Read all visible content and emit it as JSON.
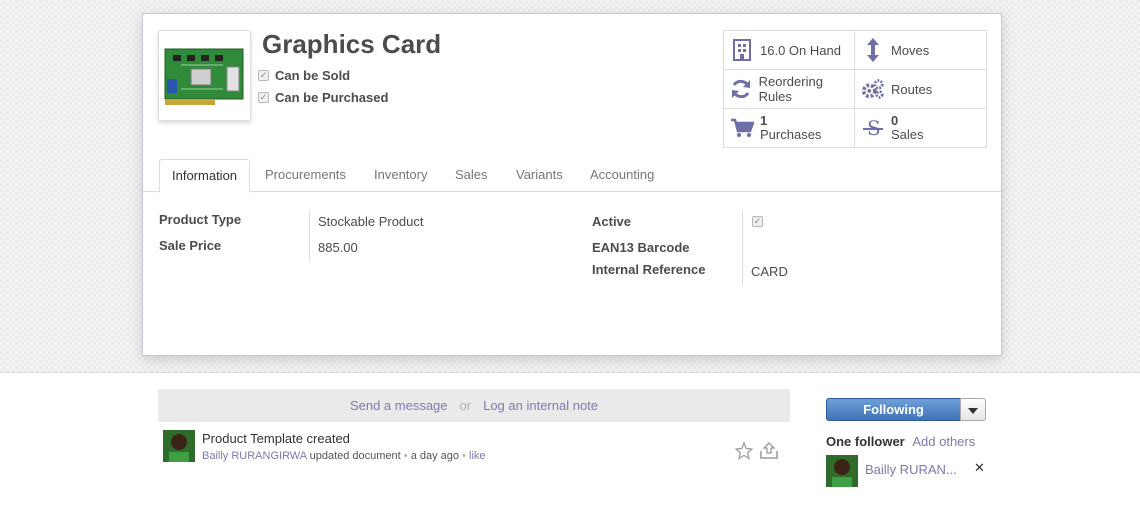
{
  "product": {
    "title": "Graphics Card",
    "can_be_sold_label": "Can be Sold",
    "can_be_purchased_label": "Can be Purchased"
  },
  "stats": {
    "on_hand": "16.0 On Hand",
    "moves": "Moves",
    "reordering_rules": "Reordering Rules",
    "routes": "Routes",
    "purchases_count": "1",
    "purchases_label": "Purchases",
    "sales_count": "0",
    "sales_label": "Sales"
  },
  "tabs": [
    {
      "label": "Information"
    },
    {
      "label": "Procurements"
    },
    {
      "label": "Inventory"
    },
    {
      "label": "Sales"
    },
    {
      "label": "Variants"
    },
    {
      "label": "Accounting"
    }
  ],
  "info": {
    "product_type_label": "Product Type",
    "product_type_value": "Stockable Product",
    "sale_price_label": "Sale Price",
    "sale_price_value": "885.00",
    "active_label": "Active",
    "ean13_label": "EAN13 Barcode",
    "internal_ref_label": "Internal Reference",
    "internal_ref_value": "CARD"
  },
  "chatter": {
    "send_message": "Send a message",
    "or": "or",
    "log_note": "Log an internal note",
    "message_title": "Product Template created",
    "author": "Bailly RURANGIRWA",
    "action": "updated document",
    "dot": "•",
    "time": "a day ago",
    "like": "like"
  },
  "followers": {
    "following_label": "Following",
    "count_label": "One follower",
    "add_others": "Add others",
    "follower_name": "Bailly RURAN...",
    "remove_symbol": "✕"
  },
  "colors": {
    "link": "#7c7bad",
    "primary_button": "#3f73b8",
    "icon": "#6f6fa8"
  }
}
